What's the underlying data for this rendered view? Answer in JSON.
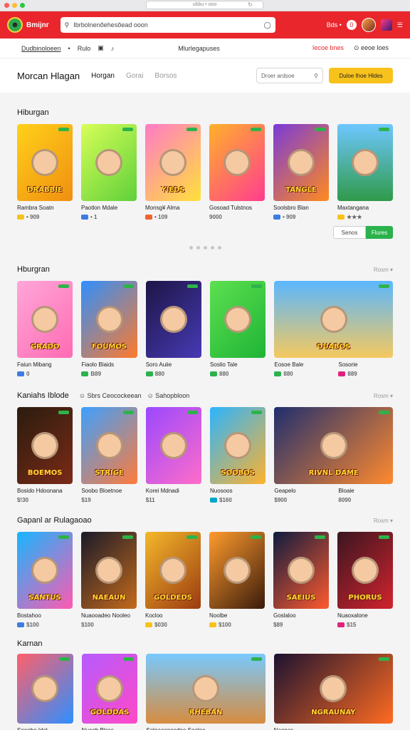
{
  "browser": {
    "url": "ubbu • ooo",
    "dots": [
      "#ff5f57",
      "#febc2e",
      "#28c840"
    ]
  },
  "header": {
    "brand": "Bmijnr",
    "search_placeholder": "Ibrbolnenõehesõead ooon",
    "right_label": "Bds •",
    "notif": "0"
  },
  "subnav": {
    "link1": "Dudbinoloeen",
    "sep": "•",
    "link2": "Rulo",
    "center": "Mlurlegapuses",
    "right1": "Iecoe bnes",
    "right2": "⊙ eeoe loes"
  },
  "pagehead": {
    "title": "Morcan Hlagan",
    "tab1": "Horgan",
    "tab2": "Gorai",
    "tab3": "Borsos",
    "search_placeholder": "Droer ardsoe",
    "cta": "Duloe Ihoe Hldes"
  },
  "sections": [
    {
      "title": "Hiburgan",
      "items": [
        {
          "name": "Rambra Soatn",
          "meta": "• 909",
          "bg": "linear-gradient(135deg,#ffd11a,#f08f10)",
          "label": "DRABBIE",
          "price_color": "#f8c21c"
        },
        {
          "name": "Paotlon Mdale",
          "meta": "• 1",
          "bg": "linear-gradient(135deg,#d7ff57,#5fd03a)",
          "label": "",
          "price_color": "#3c7de3"
        },
        {
          "name": "Monsg¥ Alma",
          "meta": "• 109",
          "bg": "linear-gradient(135deg,#ff7ac7,#ffe13a)",
          "label": "YIEDS",
          "price_color": "#f0632a"
        },
        {
          "name": "Gosoad Tulstnos",
          "meta": "9000",
          "bg": "linear-gradient(135deg,#ffb12a,#ff3d8f)",
          "label": "",
          "price_color": ""
        },
        {
          "name": "Soolsbro Blan",
          "meta": "• 909",
          "bg": "linear-gradient(135deg,#7a3bd8,#ff8a1e)",
          "label": "TANGLE",
          "price_color": "#3c7de3"
        },
        {
          "name": "Maxtangana",
          "meta": "★★★",
          "bg": "linear-gradient(180deg,#6ec7ff,#2f9a4a)",
          "label": "",
          "price_color": "#f8c21c"
        }
      ],
      "btn_secondary": "Senos",
      "btn_primary": "Flures"
    },
    {
      "title": "Hburgran",
      "more": "Rosm ▾",
      "items": [
        {
          "name": "Faiun Mibang",
          "meta": "0",
          "bg": "linear-gradient(135deg,#ffa7d8,#ff6bb4)",
          "label": "GRADO",
          "price_color": "#3c7de3"
        },
        {
          "name": "Fiaolo Blaids",
          "meta": "B89",
          "bg": "linear-gradient(135deg,#2e8fff,#ff7a2a)",
          "label": "FOUMOS",
          "price_color": "#2bb24c"
        },
        {
          "name": "Soro Auiie",
          "meta": "880",
          "bg": "linear-gradient(135deg,#1d1546,#473ab5)",
          "label": "",
          "price_color": "#2bb24c"
        },
        {
          "name": "Soslio Tale",
          "meta": "880",
          "bg": "linear-gradient(135deg,#5de04f,#1fb437)",
          "label": "",
          "price_color": "#2bb24c"
        },
        {
          "name": "Eosoe Bale",
          "meta": "880",
          "bg": "linear-gradient(180deg,#5ab7ff,#f5c95f)",
          "label": "OUABOS",
          "price_color": "#2bb24c",
          "wide": true
        },
        {
          "name": "Sosorie",
          "meta": "889",
          "bg": "",
          "label": "",
          "price_color": "#e0227d",
          "hidden": true
        }
      ]
    },
    {
      "title": "Kaniahs Iblode",
      "extra1": "☺ Sbrs Ceocockeean",
      "extra2": "☺ Sahopbloon",
      "more": "Rosm ▾",
      "items": [
        {
          "name": "Bosido Hdoonana",
          "meta": "$!30",
          "bg": "linear-gradient(135deg,#2a1c0e,#7b2a17)",
          "label": "BOEMOS",
          "price_color": ""
        },
        {
          "name": "Soobo Bloetnoe",
          "meta": "$19",
          "bg": "linear-gradient(135deg,#3da0ff,#ff7b3a)",
          "label": "STRIGE",
          "price_color": ""
        },
        {
          "name": "Korei Mdnadi",
          "meta": "$11",
          "bg": "linear-gradient(135deg,#9a48ff,#ff6dc9)",
          "label": "",
          "price_color": ""
        },
        {
          "name": "Nuosoos",
          "meta": "$160",
          "bg": "linear-gradient(135deg,#2bb5ff,#ffb22e)",
          "label": "SOOBOS",
          "price_color": "#00a7c7"
        },
        {
          "name": "Geapelo",
          "meta": "$900",
          "bg": "linear-gradient(135deg,#1f2e6e,#ff8a2e)",
          "label": "RIVNL DAME",
          "price_color": "",
          "wide": true
        }
      ],
      "extra_caption": "Bloaie",
      "extra_meta": "8090"
    },
    {
      "title": "Gapanl ar Rulagaoao",
      "more": "Rosm ▾",
      "items": [
        {
          "name": "Bostahoo",
          "meta": "$100",
          "bg": "linear-gradient(135deg,#17b6ff,#ff5ab0)",
          "label": "SANTUS",
          "price_color": "#3c7de3"
        },
        {
          "name": "Nuaooadeo Nooleo",
          "meta": "$100",
          "bg": "linear-gradient(135deg,#1a1a2a,#c46a1b)",
          "label": "NAEAUN",
          "price_color": ""
        },
        {
          "name": "Kocloo",
          "meta": "$030",
          "bg": "linear-gradient(135deg,#f4b82a,#9b3b11)",
          "label": "GOLDEDS",
          "price_color": "#f8c21c"
        },
        {
          "name": "Noolbe",
          "meta": "$100",
          "bg": "linear-gradient(135deg,#ff9b2c,#3a1b0c)",
          "label": "",
          "price_color": "#f8c21c"
        },
        {
          "name": "Goslaloo",
          "meta": "$89",
          "bg": "linear-gradient(135deg,#0e1b3f,#ff5a2e)",
          "label": "SAEIUS",
          "price_color": ""
        },
        {
          "name": "Nuaoxalone",
          "meta": "$15",
          "bg": "linear-gradient(135deg,#3a1620,#d1232e)",
          "label": "PHORUS",
          "price_color": "#e0227d"
        }
      ]
    },
    {
      "title": "Karnan",
      "items": [
        {
          "name": "Sooobo Idol",
          "meta": "",
          "bg": "linear-gradient(135deg,#ff5f6a,#2e8fff)",
          "label": "",
          "price_color": ""
        },
        {
          "name": "Nuoob Bless",
          "meta": "",
          "bg": "linear-gradient(135deg,#b65bff,#ff49c7)",
          "label": "GOLDDAS",
          "price_color": ""
        },
        {
          "name": "Soloaoanoodoe Sooloe",
          "meta": "",
          "bg": "linear-gradient(180deg,#78c9ff,#d78c3f)",
          "label": "RHEBAN",
          "price_color": "",
          "wide": true
        },
        {
          "name": "Naonas",
          "meta": "",
          "bg": "linear-gradient(135deg,#1c1230,#ff6b21)",
          "label": "NGRAUNAY",
          "price_color": "",
          "wide": true
        }
      ]
    }
  ]
}
